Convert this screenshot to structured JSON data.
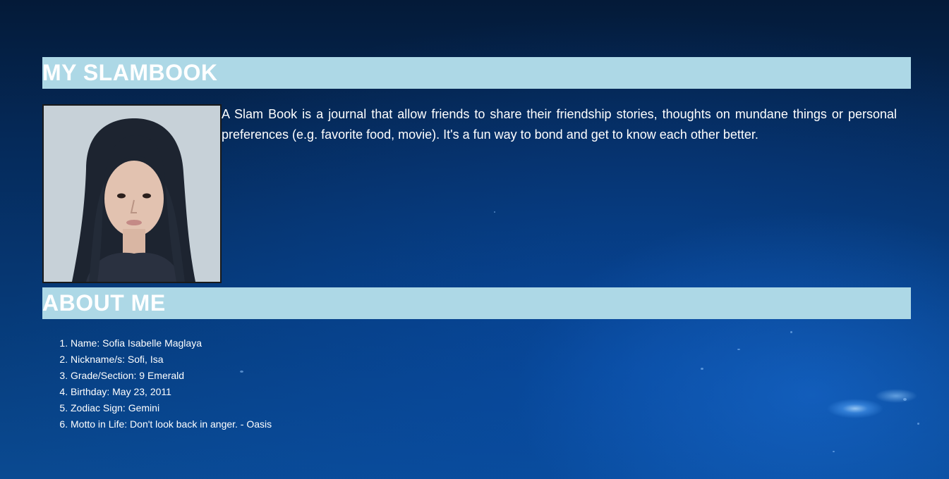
{
  "header": {
    "title": "MY SLAMBOOK"
  },
  "intro": {
    "text": "A Slam Book is a journal that allow friends to share their friendship stories, thoughts on mundane things or personal preferences (e.g. favorite food, movie). It's a fun way to bond and get to know each other better."
  },
  "profile_photo": {
    "icon": "portrait-photo"
  },
  "about": {
    "title": "ABOUT ME",
    "items": [
      "Name: Sofia Isabelle Maglaya",
      "Nickname/s: Sofi, Isa",
      "Grade/Section: 9 Emerald",
      "Birthday: May 23, 2011",
      "Zodiac Sign: Gemini",
      "Motto in Life: Don't look back in anger. - Oasis"
    ]
  },
  "colors": {
    "banner": "#add8e6",
    "text": "#ffffff",
    "background_dark": "#041a38",
    "background_light": "#0a4a92"
  }
}
